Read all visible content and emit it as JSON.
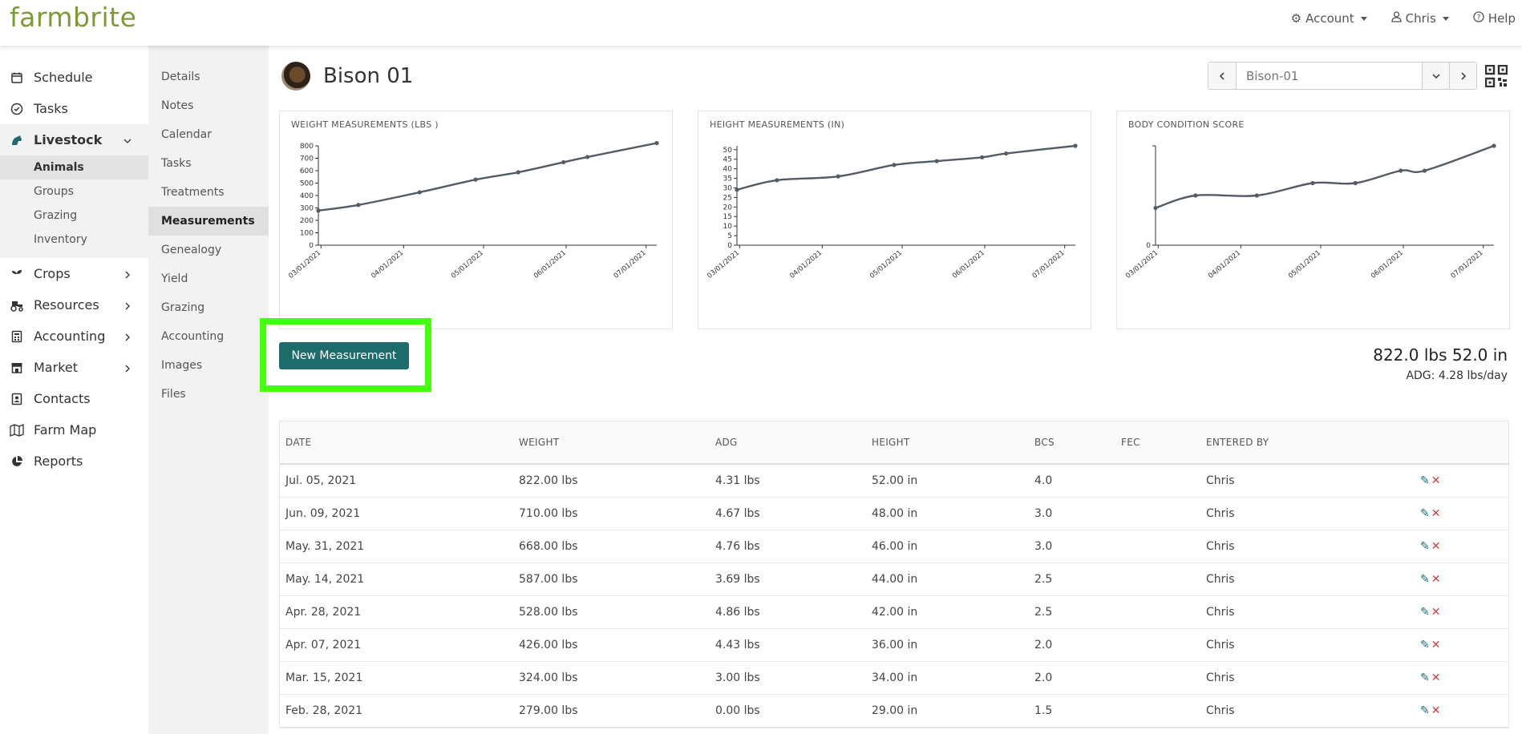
{
  "app": {
    "logo": "farmbrite"
  },
  "topnav": {
    "account": "Account",
    "user": "Chris",
    "help": "Help"
  },
  "sidebar": {
    "items": [
      {
        "label": "Schedule",
        "icon": "calendar-icon"
      },
      {
        "label": "Tasks",
        "icon": "check-circle-icon"
      },
      {
        "label": "Livestock",
        "icon": "livestock-icon",
        "expanded": true
      },
      {
        "label": "Crops",
        "icon": "sprout-icon"
      },
      {
        "label": "Resources",
        "icon": "tractor-icon"
      },
      {
        "label": "Accounting",
        "icon": "calculator-icon"
      },
      {
        "label": "Market",
        "icon": "store-icon"
      },
      {
        "label": "Contacts",
        "icon": "contact-icon"
      },
      {
        "label": "Farm Map",
        "icon": "map-icon"
      },
      {
        "label": "Reports",
        "icon": "pie-chart-icon"
      }
    ],
    "livestock_sub": [
      "Animals",
      "Groups",
      "Grazing",
      "Inventory"
    ]
  },
  "subnav": [
    "Details",
    "Notes",
    "Calendar",
    "Tasks",
    "Treatments",
    "Measurements",
    "Genealogy",
    "Yield",
    "Grazing",
    "Accounting",
    "Images",
    "Files"
  ],
  "page": {
    "title": "Bison 01",
    "animal_select_placeholder": "Bison-01"
  },
  "charts": {
    "weight_title": "WEIGHT MEASUREMENTS (LBS )",
    "height_title": "HEIGHT MEASUREMENTS (IN)",
    "bcs_title": "BODY CONDITION SCORE"
  },
  "chart_data": [
    {
      "type": "line",
      "title": "WEIGHT MEASUREMENTS (LBS )",
      "x": [
        "2021-02-28",
        "2021-03-15",
        "2021-04-07",
        "2021-04-28",
        "2021-05-14",
        "2021-05-31",
        "2021-06-09",
        "2021-07-05"
      ],
      "values": [
        279,
        324,
        426,
        528,
        587,
        668,
        710,
        822
      ],
      "xticks": [
        "03/01/2021",
        "04/01/2021",
        "05/01/2021",
        "06/01/2021",
        "07/01/2021"
      ],
      "yticks": [
        0,
        100,
        200,
        300,
        400,
        500,
        600,
        700,
        800
      ],
      "ylim": [
        0,
        800
      ]
    },
    {
      "type": "line",
      "title": "HEIGHT MEASUREMENTS (IN)",
      "x": [
        "2021-02-28",
        "2021-03-15",
        "2021-04-07",
        "2021-04-28",
        "2021-05-14",
        "2021-05-31",
        "2021-06-09",
        "2021-07-05"
      ],
      "values": [
        29,
        34,
        36,
        42,
        44,
        46,
        48,
        52
      ],
      "xticks": [
        "03/01/2021",
        "04/01/2021",
        "05/01/2021",
        "06/01/2021",
        "07/01/2021"
      ],
      "yticks": [
        0,
        5,
        10,
        15,
        20,
        25,
        30,
        35,
        40,
        45,
        50
      ],
      "ylim": [
        0,
        52
      ]
    },
    {
      "type": "line",
      "title": "BODY CONDITION SCORE",
      "x": [
        "2021-02-28",
        "2021-03-15",
        "2021-04-07",
        "2021-04-28",
        "2021-05-14",
        "2021-05-31",
        "2021-06-09",
        "2021-07-05"
      ],
      "values": [
        1.5,
        2.0,
        2.0,
        2.5,
        2.5,
        3.0,
        3.0,
        4.0
      ],
      "xticks": [
        "03/01/2021",
        "04/01/2021",
        "05/01/2021",
        "06/01/2021",
        "07/01/2021"
      ],
      "yticks": [
        0
      ],
      "ylim": [
        0,
        4
      ]
    }
  ],
  "actions": {
    "new_measurement": "New Measurement"
  },
  "summary": {
    "latest": "822.0 lbs 52.0 in",
    "adg": "ADG: 4.28 lbs/day"
  },
  "table": {
    "headers": [
      "DATE",
      "WEIGHT",
      "ADG",
      "HEIGHT",
      "BCS",
      "FEC",
      "ENTERED BY",
      ""
    ],
    "rows": [
      [
        "Jul. 05, 2021",
        "822.00 lbs",
        "4.31 lbs",
        "52.00 in",
        "4.0",
        "",
        "Chris"
      ],
      [
        "Jun. 09, 2021",
        "710.00 lbs",
        "4.67 lbs",
        "48.00 in",
        "3.0",
        "",
        "Chris"
      ],
      [
        "May. 31, 2021",
        "668.00 lbs",
        "4.76 lbs",
        "46.00 in",
        "3.0",
        "",
        "Chris"
      ],
      [
        "May. 14, 2021",
        "587.00 lbs",
        "3.69 lbs",
        "44.00 in",
        "2.5",
        "",
        "Chris"
      ],
      [
        "Apr. 28, 2021",
        "528.00 lbs",
        "4.86 lbs",
        "42.00 in",
        "2.5",
        "",
        "Chris"
      ],
      [
        "Apr. 07, 2021",
        "426.00 lbs",
        "4.43 lbs",
        "36.00 in",
        "2.0",
        "",
        "Chris"
      ],
      [
        "Mar. 15, 2021",
        "324.00 lbs",
        "3.00 lbs",
        "34.00 in",
        "2.0",
        "",
        "Chris"
      ],
      [
        "Feb. 28, 2021",
        "279.00 lbs",
        "0.00 lbs",
        "29.00 in",
        "1.5",
        "",
        "Chris"
      ]
    ]
  },
  "colors": {
    "brand": "#7c9a3a",
    "primary": "#1e6b6b",
    "highlight": "#46ff12",
    "line": "#555b62",
    "delete": "#d43a3a"
  }
}
